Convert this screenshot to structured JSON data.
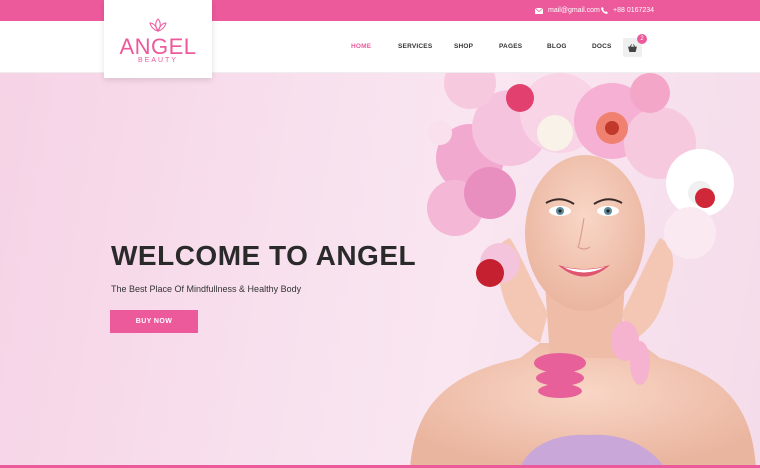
{
  "topbar": {
    "email": "mail@gmail.com",
    "phone": "+88 0167234",
    "bg_color": "#ec5a9c"
  },
  "logo": {
    "brand": "ANGEL",
    "tagline": "BEAUTY",
    "icon": "lotus-icon"
  },
  "nav": {
    "items": [
      {
        "label": "HOME",
        "active": true
      },
      {
        "label": "SERVICES",
        "active": false
      },
      {
        "label": "SHOP",
        "active": false
      },
      {
        "label": "PAGES",
        "active": false
      },
      {
        "label": "BLOG",
        "active": false
      },
      {
        "label": "DOCS",
        "active": false
      }
    ],
    "cart_count": "2",
    "cart_icon": "basket-icon"
  },
  "hero": {
    "title": "WELCOME TO ANGEL",
    "subtitle": "The Best Place Of Mindfullness & Healthy Body",
    "cta_label": "BUY NOW",
    "accent_color": "#ec5a9c"
  }
}
